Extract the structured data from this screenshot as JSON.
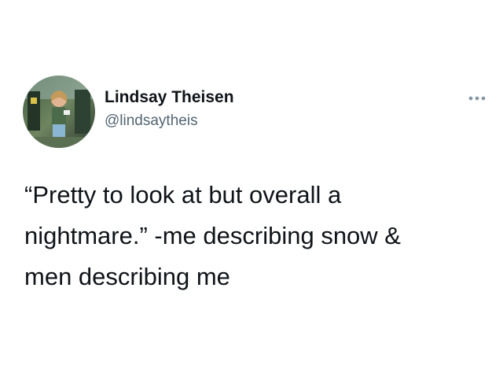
{
  "author": {
    "name": "Lindsay Theisen",
    "handle": "@lindsaytheis",
    "avatar_icon": "profile-photo"
  },
  "menu": {
    "icon": "more-options-icon"
  },
  "tweet": {
    "lines": [
      "“Pretty to look at but overall a",
      "nightmare.” -me describing snow &",
      "men describing me"
    ]
  },
  "colors": {
    "text": "#0f1419",
    "secondary_text": "#536471",
    "menu_dots": "#8899a6",
    "background": "#ffffff"
  }
}
